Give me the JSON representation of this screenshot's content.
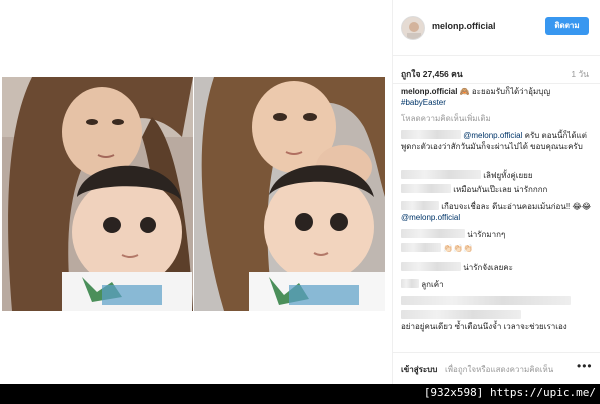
{
  "post": {
    "username": "melonp.official",
    "follow_label": "ติดตาม",
    "likes": "ถูกใจ 27,456 คน",
    "time": "1 วัน",
    "caption_user": "melonp.official",
    "caption_text": "🙈 อะยอมรับก็ได้ว่าอุ้มบุญ",
    "caption_tag": "#babyEaster",
    "load_more": "โหลดความคิดเห็นเพิ่มเติม"
  },
  "comments": [
    {
      "mention": "@melonp.official",
      "text": "ครับ ตอนนี้ก็ได้แต่พูดกะตัวเองว่าสักวันมันก็จะผ่านไปได้ ขอบคุณนะครับ"
    },
    {
      "text": "เลิฟยูทั้งคู่เยยย"
    },
    {
      "text": "เหมือนกันเป๊ะเลย น่ารักกกก"
    },
    {
      "text": "เกือบจะเชื่อละ ดีนะอ่านคอมเม้นก่อน!! 😂😂",
      "mention": "@melonp.official"
    },
    {
      "text": "น่ารักมากๆ"
    },
    {
      "text": "👏🏻👏🏻👏🏻"
    },
    {
      "text": "น่ารักจังเลยคะ"
    },
    {
      "text": "ลูกเค้า"
    },
    {
      "text": "อย่าอยู่คนเดียว ซ้ำเตือนนึงจ้ำ เวลาจะช่วยเราเอง"
    }
  ],
  "footer": {
    "login_label": "เข้าสู่ระบบ",
    "login_hint": "เพื่อถูกใจหรือแสดงความคิดเห็น",
    "more_icon": "more-horizontal-icon",
    "more_glyph": "•••"
  },
  "watermark": "[932x598] https://upic.me/"
}
